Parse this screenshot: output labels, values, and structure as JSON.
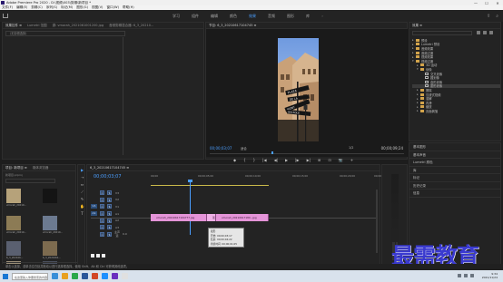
{
  "title_bar": {
    "title": "Adobe Premiere Pro 2020 - D:\\视频\\003\\剪辑\\新项目 *",
    "buttons": [
      "—",
      "☐",
      "✕"
    ]
  },
  "menu": [
    "文件(F)",
    "编辑(E)",
    "剪辑(C)",
    "序列(S)",
    "标记(M)",
    "图形(G)",
    "视图(V)",
    "窗口(W)",
    "帮助(H)"
  ],
  "workspaces": {
    "tabs": [
      "学习",
      "组件",
      "编辑",
      "颜色",
      "效果",
      "音频",
      "图形",
      "库"
    ],
    "active": "效果",
    "separator": "»"
  },
  "source_panel": {
    "tabs": [
      "效果控件 ≡",
      "Lumetri 范围",
      "源: vmorah_2021061001200.jpg",
      "音频剪辑混合器: 6_3_20210..."
    ],
    "active_tab": "效果控件 ≡",
    "sub": "（无剪辑选择）"
  },
  "program_monitor": {
    "tab": "节目: 6_3_20210617104745 ≡",
    "timecode": "00;00;03;07",
    "fit": "适合",
    "zoom": "1/2",
    "duration": "00;00;09;24",
    "street_signs": [
      "PLAZA",
      "DE LA",
      "MONT",
      "BALSOLE"
    ],
    "transport": [
      "◆",
      "{",
      "}",
      "|◀",
      "◀|",
      "▶",
      "|▶",
      "▶|",
      "⊞",
      "⊡",
      "📷",
      "+"
    ]
  },
  "effects_panel": {
    "tab": "效果 ≡",
    "items": [
      {
        "type": "folder",
        "label": "预设"
      },
      {
        "type": "folder",
        "label": "Lumetri 预设"
      },
      {
        "type": "folder",
        "label": "音频效果"
      },
      {
        "type": "folder",
        "label": "音频过渡"
      },
      {
        "type": "folder",
        "label": "视频效果"
      },
      {
        "type": "folder",
        "label": "视频过渡",
        "open": true
      },
      {
        "type": "folder",
        "label": "3D 运动",
        "indent": 1
      },
      {
        "type": "folder",
        "label": "划像",
        "indent": 1,
        "open": true
      },
      {
        "type": "fx",
        "label": "交叉划像",
        "indent": 2
      },
      {
        "type": "fx",
        "label": "圆划像",
        "indent": 2
      },
      {
        "type": "fx",
        "label": "盒形划像",
        "indent": 2
      },
      {
        "type": "fx",
        "label": "菱形划像",
        "indent": 2,
        "selected": true
      },
      {
        "type": "folder",
        "label": "擦除",
        "indent": 1
      },
      {
        "type": "folder",
        "label": "沉浸式视频",
        "indent": 1
      },
      {
        "type": "folder",
        "label": "溶解",
        "indent": 1
      },
      {
        "type": "folder",
        "label": "内滑",
        "indent": 1
      },
      {
        "type": "folder",
        "label": "缩放",
        "indent": 1
      },
      {
        "type": "folder",
        "label": "页面剥落",
        "indent": 1
      }
    ]
  },
  "right_lower_panel": {
    "rows": [
      "基本图形",
      "基本声音",
      "Lumetri 颜色",
      "库",
      "标记",
      "历史记录",
      "信息"
    ]
  },
  "project_panel": {
    "tabs": [
      "项目: 新项目 ≡",
      "媒体浏览器"
    ],
    "path": "新项目.prproj",
    "thumbs": [
      {
        "label": "vmorah_20210...",
        "color": "#b6a27a"
      },
      {
        "label": "",
        "color": "#141414"
      },
      {
        "label": "vmorah_20210...",
        "color": "#8c7b55"
      },
      {
        "label": "vmorah_20210...",
        "color": "#6c7a90"
      },
      {
        "label": "6_3_202106...",
        "color": "#5a6070"
      },
      {
        "label": "6_3_2021061...",
        "color": "#7d6b4f"
      },
      {
        "label": "",
        "color": "#9a8e78"
      },
      {
        "label": "",
        "color": "#4a4f5c"
      }
    ]
  },
  "tools": [
    "▶",
    "⇢",
    "⇔",
    "⟋",
    "✎",
    "✋",
    "T"
  ],
  "timeline": {
    "tab": "6_3_20210617104745 ≡",
    "timecode": "00;00;03;07",
    "ruler": [
      "00;00",
      "00;00;05;00",
      "00;00;10;00",
      "00;00;15;00",
      "00;00;20;00",
      "00;00;25;00"
    ],
    "tracks": [
      {
        "name": "V3",
        "src": "",
        "label": "V3"
      },
      {
        "name": "V2",
        "src": "",
        "label": "V2"
      },
      {
        "name": "V1",
        "src": "V1",
        "label": "V1"
      },
      {
        "name": "A1",
        "src": "A1",
        "label": "A1"
      },
      {
        "name": "A2",
        "src": "",
        "label": "A2"
      },
      {
        "name": "A3",
        "src": "",
        "label": "A3"
      },
      {
        "name": "主声道",
        "src": "",
        "label": "主声道",
        "value": "0.0"
      }
    ],
    "clips": [
      {
        "label": "vmorah_20210617104777.jpg",
        "selected": false
      },
      {
        "label": "菱形",
        "selected": true
      },
      {
        "label": "vmorah_20210617180...jpg",
        "selected": false
      }
    ],
    "tooltip": [
      "菱形",
      "开始: 00;00;03;17",
      "结束: 00;00;04;22",
      "持续时间: 00;00;01;05"
    ]
  },
  "status_bar": "单击以选择，或单击空白处并拖动以进行选择框选择。使用 Shift、Alt 和 Ctrl 可获得其他选项。",
  "watermark": "最需教育",
  "taskbar": {
    "search": "在这里输入你要搜索的内容",
    "apps": [
      "#3a8fd8",
      "#e8a020",
      "#2aa84a",
      "#2b579a",
      "#d24726",
      "#1e90ff",
      "#6b2fbf",
      "#e0e0e0"
    ],
    "time": "9:34",
    "date": "2021/11/24"
  }
}
